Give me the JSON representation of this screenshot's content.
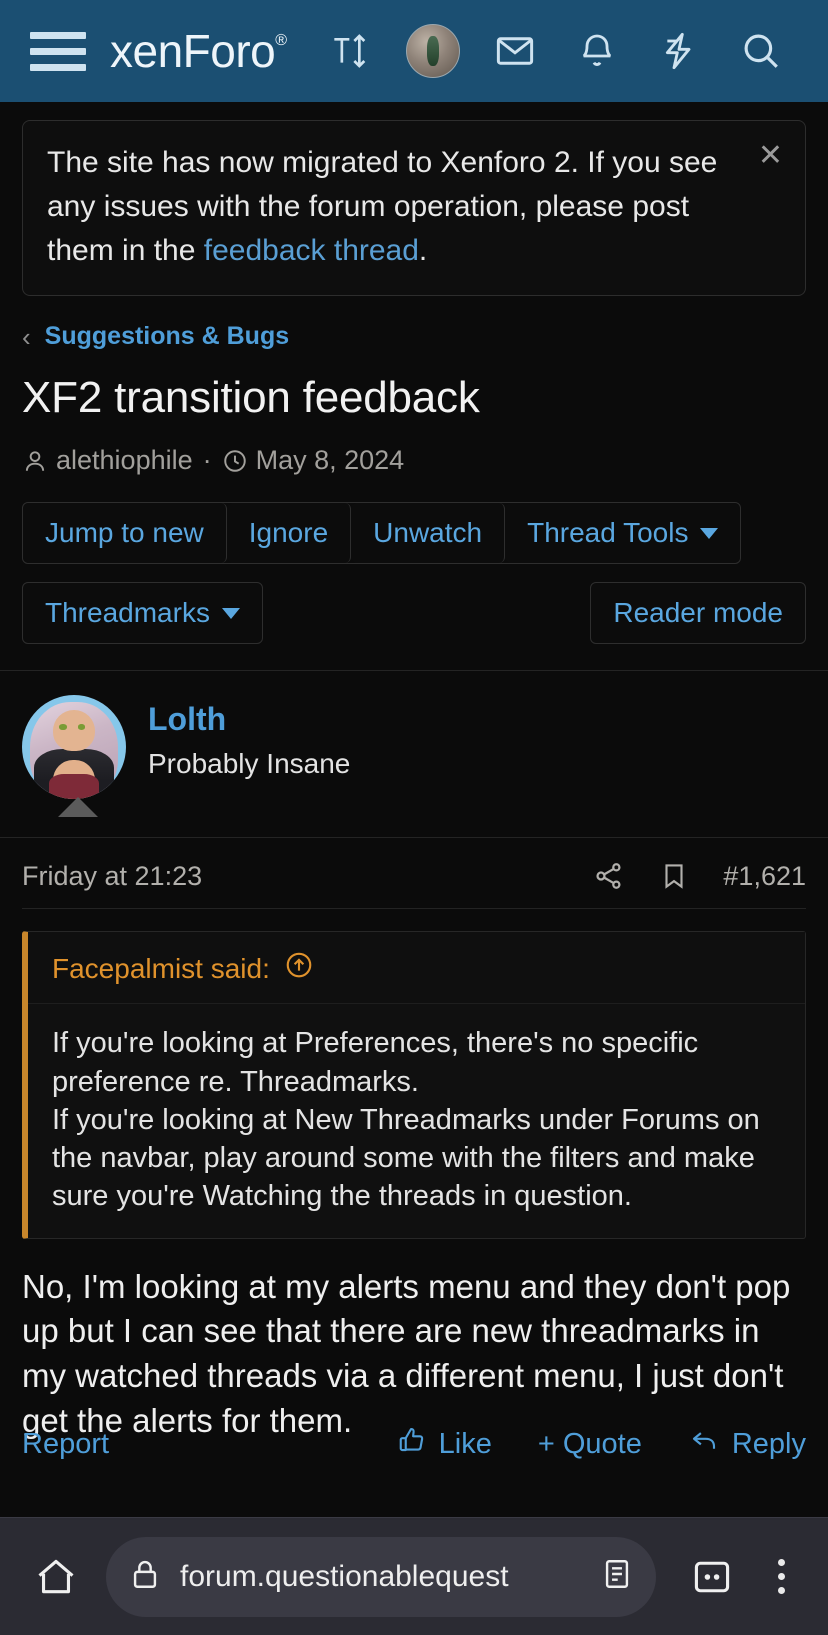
{
  "navbar": {
    "brand": "xenForo",
    "brand_tm": "®",
    "icons": [
      {
        "name": "hamburger-menu",
        "label": "Menu"
      },
      {
        "name": "text-size-icon",
        "label": "Text size"
      },
      {
        "name": "account-avatar",
        "label": "Account"
      },
      {
        "name": "inbox-icon",
        "label": "Inbox"
      },
      {
        "name": "alerts-bell-icon",
        "label": "Alerts"
      },
      {
        "name": "whats-new-icon",
        "label": "What's new"
      },
      {
        "name": "search-icon",
        "label": "Search"
      }
    ]
  },
  "notice": {
    "text_before": "The site has now migrated to Xenforo 2. If you see any issues with the forum operation, please post them in the ",
    "link": "feedback thread",
    "text_after": ".",
    "close_label": "✕"
  },
  "breadcrumb": {
    "back_caret": "‹",
    "parent": "Suggestions & Bugs"
  },
  "thread": {
    "title": "XF2 transition feedback",
    "author": "alethiophile",
    "separator": "·",
    "date": "May 8, 2024"
  },
  "toolbar": {
    "group": [
      "Jump to new",
      "Ignore",
      "Unwatch"
    ],
    "thread_tools": "Thread Tools",
    "threadmarks": "Threadmarks",
    "reader_mode": "Reader mode"
  },
  "post": {
    "author_name": "Lolth",
    "author_title": "Probably Insane",
    "timestamp": "Friday at 21:23",
    "post_number": "#1,621",
    "quote": {
      "header": "Facepalmist said:",
      "lines": [
        "If you're looking at Preferences, there's no specific preference re. Threadmarks.",
        "If you're looking at New Threadmarks under Forums on the navbar, play around some with the filters and make sure you're Watching the threads in question."
      ]
    },
    "body": "No, I'm looking at my alerts menu and they don't pop up but I can see that there are new threadmarks in my watched threads via a different menu, I just don't get the alerts for them.",
    "actions": {
      "report": "Report",
      "like": "Like",
      "quote": "+ Quote",
      "reply": "Reply"
    }
  },
  "browser": {
    "url": "forum.questionablequest",
    "tab_count": "∞"
  },
  "colors": {
    "navbar": "#1b4f72",
    "link": "#4f9ed9",
    "quote_accent": "#c8862b",
    "page_bg": "#0b0b0b"
  }
}
